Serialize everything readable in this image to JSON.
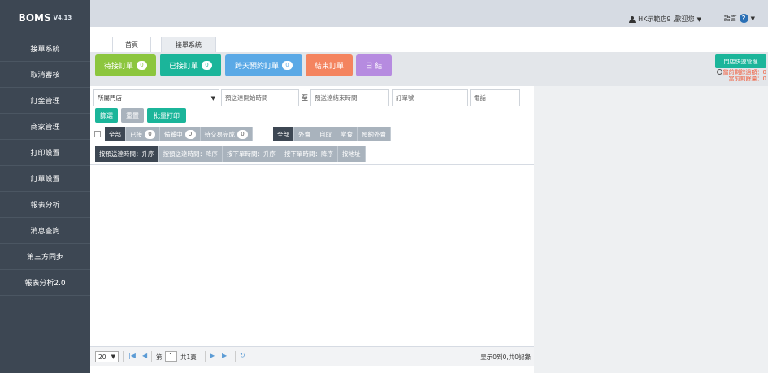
{
  "brand": {
    "name": "BOMS",
    "version": "V4.13"
  },
  "sidebar": {
    "items": [
      {
        "label": "接單系統"
      },
      {
        "label": "取消審核"
      },
      {
        "label": "訂金管理"
      },
      {
        "label": "商家管理"
      },
      {
        "label": "打印設置"
      },
      {
        "label": "訂單設置"
      },
      {
        "label": "報表分析"
      },
      {
        "label": "消息查詢"
      },
      {
        "label": "第三方同步"
      },
      {
        "label": "報表分析2.0"
      }
    ]
  },
  "topbar": {
    "user": "HK示範店9 ,歡迎您",
    "language": "語言"
  },
  "tabs": [
    {
      "label": "首頁"
    },
    {
      "label": "接單系統"
    }
  ],
  "status": [
    {
      "label": "待接訂單",
      "count": "0",
      "color": "#8cc63e"
    },
    {
      "label": "已接訂單",
      "count": "0",
      "color": "#1bb59a"
    },
    {
      "label": "跨天預約訂單",
      "count": "0",
      "color": "#5aa9e6"
    },
    {
      "label": "結束訂單",
      "count": "",
      "color": "#f4845f"
    },
    {
      "label": "日 結",
      "count": "",
      "color": "#b68be0"
    }
  ],
  "quick": {
    "button": "門店快速管理",
    "line1": "當前剩餘過額：0",
    "line2": "當前剩餘量：0"
  },
  "filters": {
    "store_select": "所屬門店",
    "start_time": "預送達開始時間",
    "to": "至",
    "end_time": "預送達結束時間",
    "order_no": "訂單號",
    "phone": "電話"
  },
  "actions": {
    "filter": "篩選",
    "reset": "重置",
    "batch_print": "批量打印"
  },
  "state_seg": [
    {
      "label": "全部",
      "count": "",
      "dark": true
    },
    {
      "label": "已接",
      "count": "0",
      "dark": false
    },
    {
      "label": "備餐中",
      "count": "0",
      "dark": false
    },
    {
      "label": "待交易完成",
      "count": "0",
      "dark": false
    }
  ],
  "type_seg": [
    {
      "label": "全部",
      "dark": true
    },
    {
      "label": "外賣",
      "dark": false
    },
    {
      "label": "自取",
      "dark": false
    },
    {
      "label": "堂食",
      "dark": false
    },
    {
      "label": "預約外賣",
      "dark": false
    }
  ],
  "sorts": [
    {
      "label": "按預送達時間：升序",
      "dark": true
    },
    {
      "label": "按預送達時間：降序",
      "dark": false
    },
    {
      "label": "按下單時間：升序",
      "dark": false
    },
    {
      "label": "按下單時間：降序",
      "dark": false
    },
    {
      "label": "按地址",
      "dark": false
    }
  ],
  "pager": {
    "page_size": "20",
    "page_label": "第",
    "page_value": "1",
    "total_label": "共1頁",
    "info": "显示0到0,共0記錄"
  }
}
